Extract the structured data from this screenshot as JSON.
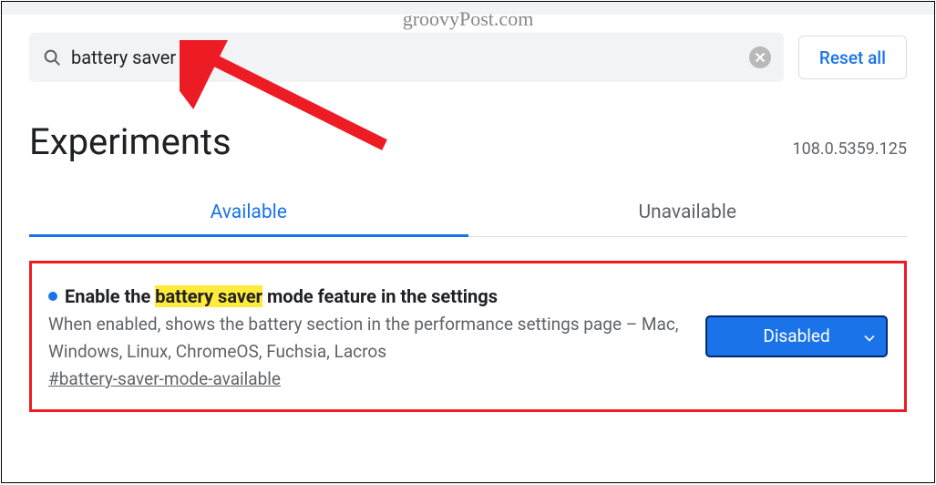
{
  "watermark": "groovyPost.com",
  "search": {
    "value": "battery saver"
  },
  "reset_label": "Reset all",
  "page_title": "Experiments",
  "version": "108.0.5359.125",
  "tabs": {
    "available": "Available",
    "unavailable": "Unavailable"
  },
  "flag": {
    "title_before": "Enable the ",
    "title_highlight": "battery saver",
    "title_after": " mode feature in the settings",
    "description": "When enabled, shows the battery section in the performance settings page – Mac, Windows, Linux, ChromeOS, Fuchsia, Lacros",
    "anchor": "#battery-saver-mode-available",
    "select_value": "Disabled"
  }
}
